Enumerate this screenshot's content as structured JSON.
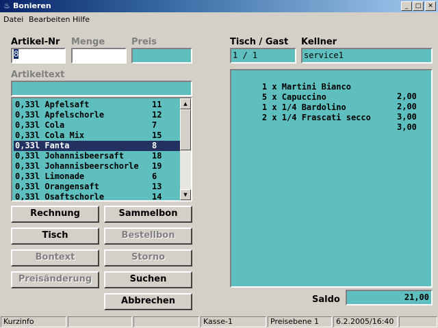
{
  "window": {
    "title": "Bonieren",
    "app_icon": "app-icon"
  },
  "menu": [
    "Datei",
    "Bearbeiten",
    "Hilfe"
  ],
  "fields": {
    "artikel_nr": {
      "label": "Artikel-Nr",
      "value": "8"
    },
    "menge": {
      "label": "Menge",
      "value": ""
    },
    "preis": {
      "label": "Preis",
      "value": ""
    },
    "tisch": {
      "label": "Tisch / Gast",
      "value": "1 / 1"
    },
    "kellner": {
      "label": "Kellner",
      "value": "service1"
    },
    "artikeltext": {
      "label": "Artikeltext",
      "value": ""
    }
  },
  "articles": [
    {
      "name": "0,33l Apfelsaft",
      "num": "11"
    },
    {
      "name": "0,33l Apfelschorle",
      "num": "12"
    },
    {
      "name": "0,33l Cola",
      "num": "7"
    },
    {
      "name": "0,33l Cola Mix",
      "num": "15"
    },
    {
      "name": "0,33l Fanta",
      "num": "8"
    },
    {
      "name": "0,33l Johannisbeersaft",
      "num": "18"
    },
    {
      "name": "0,33l Johannisbeerschorle",
      "num": "19"
    },
    {
      "name": "0,33l Limonade",
      "num": "6"
    },
    {
      "name": "0,33l Orangensaft",
      "num": "13"
    },
    {
      "name": "0,33l Osaftschorle",
      "num": "14"
    }
  ],
  "selected_article_index": 4,
  "buttons": {
    "rechnung": "Rechnung",
    "sammelbon": "Sammelbon",
    "tisch": "Tisch",
    "bestellbon": "Bestellbon",
    "bontext": "Bontext",
    "storno": "Storno",
    "preisaenderung": "Preisänderung",
    "suchen": "Suchen",
    "abbrechen": "Abbrechen"
  },
  "orders": [
    {
      "text": "1 x Martini Bianco",
      "amount": "2,00"
    },
    {
      "text": "5 x Capuccino",
      "amount": "2,00"
    },
    {
      "text": "1 x 1/4 Bardolino",
      "amount": "3,00"
    },
    {
      "text": "2 x 1/4 Frascati secco",
      "amount": "3,00"
    }
  ],
  "saldo": {
    "label": "Saldo",
    "value": "21,00"
  },
  "status": [
    "Kurzinfo",
    "",
    "",
    "Kasse-1",
    "Preisebene 1",
    "6.2.2005/16:40"
  ],
  "colors": {
    "field_bg": "#5fbfbf",
    "selection": "#22315f",
    "face": "#d4d0c8"
  }
}
